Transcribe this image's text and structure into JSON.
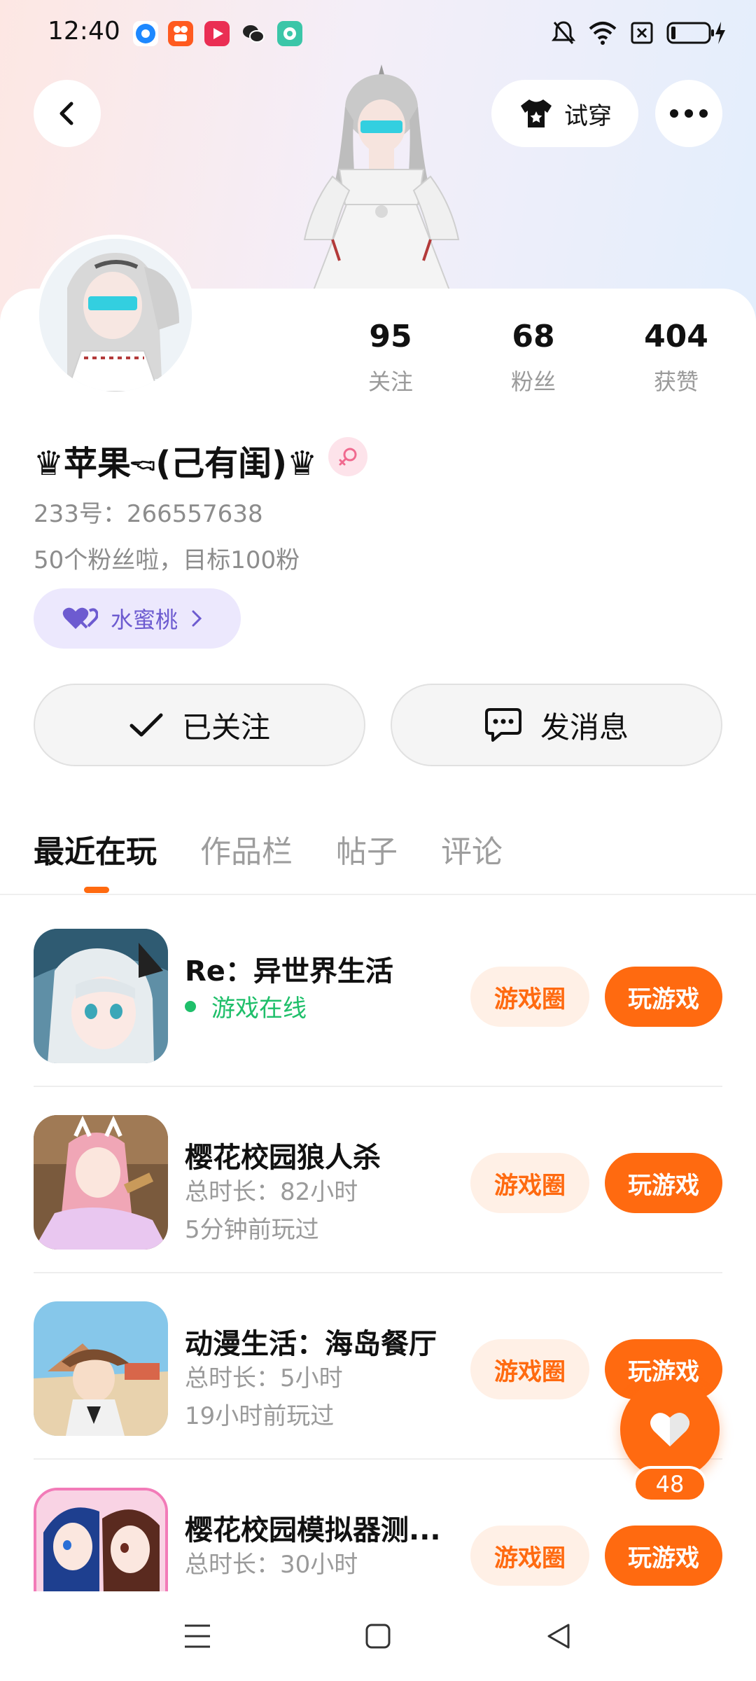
{
  "status_bar": {
    "time": "12:40",
    "notification_icons": [
      "browser-icon",
      "kuaishou-icon",
      "video-app-icon",
      "wechat-icon",
      "chat-app-icon"
    ],
    "system_icons": [
      "mute-bell-icon",
      "wifi-icon",
      "sim-off-icon",
      "battery-charging-icon"
    ]
  },
  "header": {
    "back_icon": "back-arrow-icon",
    "tryon_label": "试穿",
    "more_icon": "more-dots-icon"
  },
  "profile": {
    "username": "♛苹果🖘(己有闺)♛",
    "gender_icon": "female-icon",
    "uid": "233号：266557638",
    "bio": "50个粉丝啦，目标100粉",
    "tag_label": "水蜜桃",
    "stats": [
      {
        "value": "95",
        "label": "关注"
      },
      {
        "value": "68",
        "label": "粉丝"
      },
      {
        "value": "404",
        "label": "获赞"
      }
    ]
  },
  "actions": {
    "follow_label": "已关注",
    "message_label": "发消息"
  },
  "tabs": [
    "最近在玩",
    "作品栏",
    "帖子",
    "评论"
  ],
  "games": [
    {
      "name": "Re：异世界生活",
      "status": "游戏在线",
      "circle_label": "游戏圈",
      "play_label": "玩游戏"
    },
    {
      "name": "樱花校园狼人杀",
      "duration": "总时长：82小时",
      "last_played": "5分钟前玩过",
      "circle_label": "游戏圈",
      "play_label": "玩游戏"
    },
    {
      "name": "动漫生活：海岛餐厅",
      "duration": "总时长：5小时",
      "last_played": "19小时前玩过",
      "circle_label": "游戏圈",
      "play_label": "玩游戏"
    },
    {
      "name": "樱花校园模拟器测...",
      "duration": "总时长：30小时",
      "circle_label": "游戏圈",
      "play_label": "玩游戏"
    }
  ],
  "fab": {
    "count": "48"
  },
  "colors": {
    "accent": "#ff6a10",
    "online": "#1fbf6a",
    "tag_text": "#6d5bd0"
  }
}
